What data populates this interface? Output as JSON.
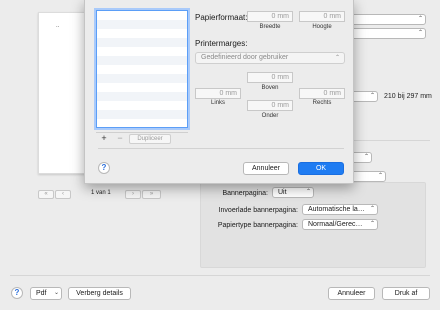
{
  "print_dialog": {
    "page_indicator": "1 van 1",
    "first_page_btn": "«",
    "prev_page_btn": "‹",
    "next_page_btn": "›",
    "last_page_btn": "»",
    "preview_mark": "..",
    "paper_size_text": "210 bij 297 mm",
    "options": {
      "banner_label": "Bannerpagina:",
      "banner_value": "Uit",
      "insert_banner_label": "Invoerlade bannerpagina:",
      "insert_banner_value": "Automatische la…",
      "type_banner_label": "Papiertype bannerpagina:",
      "type_banner_value": "Normaal/Gerec…"
    },
    "footer": {
      "help": "?",
      "pdf_label": "Pdf",
      "hide_details_label": "Verberg details",
      "cancel_label": "Annuleer",
      "print_label": "Druk af"
    }
  },
  "sheet": {
    "paper_format_title": "Papierformaat:",
    "width_value": "0 mm",
    "width_caption": "Breedte",
    "height_value": "0 mm",
    "height_caption": "Hoogte",
    "margins_title": "Printermarges:",
    "margins_select": "Gedefinieerd door gebruiker",
    "top_value": "0 mm",
    "top_caption": "Boven",
    "left_value": "0 mm",
    "left_caption": "Links",
    "right_value": "0 mm",
    "right_caption": "Rechts",
    "bottom_value": "0 mm",
    "bottom_caption": "Onder",
    "plus_label": "+",
    "minus_label": "−",
    "duplicate_label": "Dupliceer",
    "help": "?",
    "cancel_label": "Annuleer",
    "ok_label": "OK"
  },
  "icons": {
    "chevron": "updown-chevron-icon",
    "dropdown": "dropdown-chevron-icon"
  },
  "colors": {
    "accent": "#1f7cf2",
    "selection_border": "#5b9ef7",
    "background": "#ececec"
  }
}
